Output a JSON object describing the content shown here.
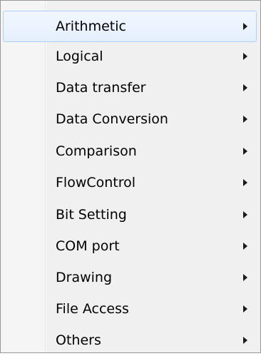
{
  "menu": {
    "items": [
      {
        "label": "Arithmetic",
        "has_submenu": true,
        "highlighted": true
      },
      {
        "label": "Logical",
        "has_submenu": true
      },
      {
        "label": "Data transfer",
        "has_submenu": true
      },
      {
        "label": "Data Conversion",
        "has_submenu": true
      },
      {
        "label": "Comparison",
        "has_submenu": true
      },
      {
        "label": "FlowControl",
        "has_submenu": true
      },
      {
        "label": "Bit Setting",
        "has_submenu": true
      },
      {
        "label": "COM port",
        "has_submenu": true
      },
      {
        "label": "Drawing",
        "has_submenu": true
      },
      {
        "label": "File Access",
        "has_submenu": true
      },
      {
        "label": "Others",
        "has_submenu": true
      }
    ],
    "colors": {
      "highlight_border": "#aecff7",
      "highlight_fill": "#e4effd",
      "background": "#f0f0f0"
    },
    "submenu_icon": "chevron-right-icon"
  }
}
